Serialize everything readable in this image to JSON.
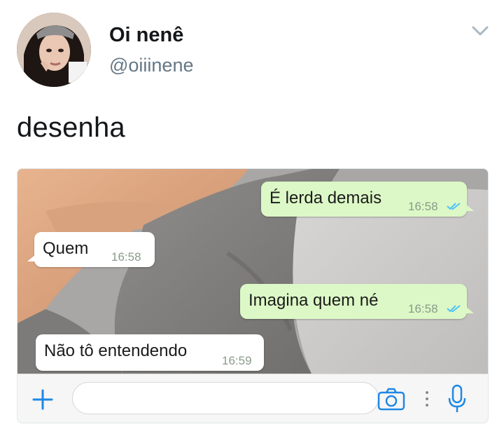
{
  "tweet": {
    "display_name": "Oi nenê",
    "username": "@oiiinene",
    "text": "desenha"
  },
  "chat": {
    "messages": [
      {
        "direction": "outgoing",
        "text": "É lerda demais",
        "time": "16:58",
        "status": "read"
      },
      {
        "direction": "incoming",
        "text": "Quem",
        "time": "16:58"
      },
      {
        "direction": "outgoing",
        "text": "Imagina quem né",
        "time": "16:58",
        "status": "read"
      },
      {
        "direction": "incoming",
        "text": "Não tô entendendo",
        "time": "16:59"
      }
    ],
    "input_bar": {
      "icons": [
        "plus-icon",
        "camera-icon",
        "more-dots-icon",
        "mic-icon"
      ]
    }
  },
  "colors": {
    "outgoing_bubble": "#dcf8c6",
    "incoming_bubble": "#ffffff",
    "read_ticks": "#4fc3f7",
    "whatsapp_blue": "#1e88e5",
    "username_gray": "#657786"
  }
}
